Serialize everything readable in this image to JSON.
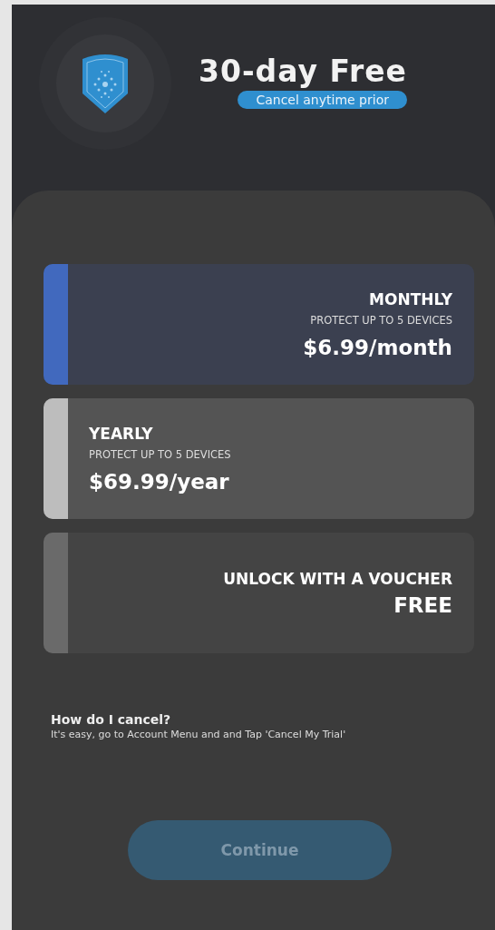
{
  "header": {
    "title": "30-day Free",
    "badge": "Cancel anytime prior"
  },
  "plans": [
    {
      "kind": "plan",
      "selected": true,
      "color": "#4169be",
      "title": "MONTHLY",
      "subtitle": "PROTECT UP TO 5 DEVICES",
      "price": "$6.99/month"
    },
    {
      "kind": "plan",
      "selected": false,
      "color": "#bdbdbd",
      "title": "YEARLY",
      "subtitle": "PROTECT UP TO 5 DEVICES",
      "price": "$69.99/year"
    },
    {
      "kind": "voucher",
      "selected": false,
      "color": "#6a6a6a",
      "title": "UNLOCK WITH A VOUCHER",
      "price": "FREE"
    }
  ],
  "help": {
    "question": "How do I cancel?",
    "answer": "It's easy, go to Account Menu and and Tap 'Cancel My Trial'"
  },
  "continue_button": {
    "label": "Continue",
    "disabled": true
  }
}
